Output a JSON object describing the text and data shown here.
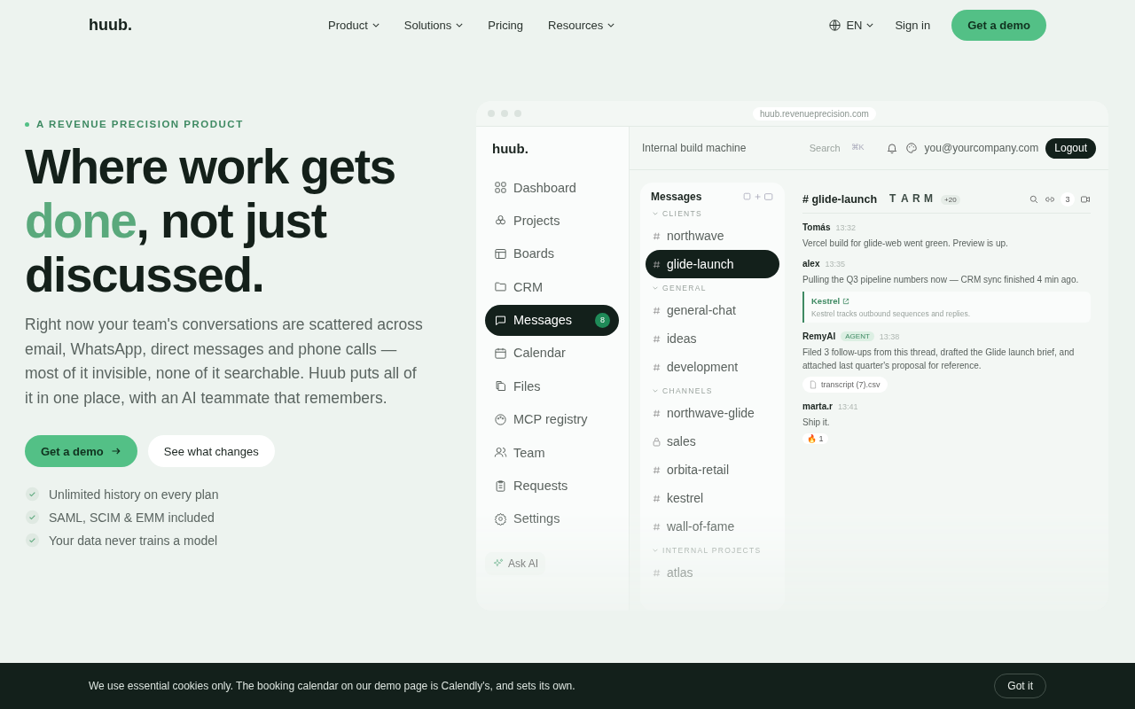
{
  "nav": {
    "logo": "huub.",
    "links": [
      {
        "label": "Product",
        "dropdown": true
      },
      {
        "label": "Solutions",
        "dropdown": true
      },
      {
        "label": "Pricing",
        "dropdown": false
      },
      {
        "label": "Resources",
        "dropdown": true
      }
    ],
    "language": "EN",
    "sign_in": "Sign in",
    "cta": "Get a demo"
  },
  "hero": {
    "eyebrow": "A REVENUE PRECISION PRODUCT",
    "headline": [
      {
        "text": "Where work gets ",
        "accent": false
      },
      {
        "text": "done",
        "accent": true
      },
      {
        "text": ", not just discussed.",
        "accent": false
      }
    ],
    "body": "Right now your team's conversations are scattered across email, WhatsApp, direct messages and phone calls — most of it invisible, none of it searchable. Huub puts all of it in one place, with an AI teammate that remembers.",
    "primary_button": "Get a demo",
    "secondary_button": "See what changes",
    "checks": [
      "Unlimited history on every plan",
      "SAML, SCIM & EMM included",
      "Your data never trains a model"
    ]
  },
  "app": {
    "url": "huub.revenueprecision.com",
    "logo": "huub.",
    "workspace": "Internal build machine",
    "search": {
      "placeholder": "Search",
      "shortcut": "⌘K"
    },
    "user": "you@yourcompany.com",
    "logout": "Logout",
    "sidebar": [
      {
        "label": "Dashboard",
        "selected": false
      },
      {
        "label": "Projects",
        "selected": false
      },
      {
        "label": "Boards",
        "selected": false
      },
      {
        "label": "CRM",
        "selected": false
      },
      {
        "label": "Messages",
        "selected": true,
        "badge": "8"
      },
      {
        "label": "Calendar",
        "selected": false
      },
      {
        "label": "Files",
        "selected": false
      },
      {
        "label": "MCP registry",
        "selected": false
      },
      {
        "label": "Team",
        "selected": false
      },
      {
        "label": "Requests",
        "selected": false
      },
      {
        "label": "Settings",
        "selected": false
      }
    ],
    "ask_ai": "Ask AI",
    "channels_title": "Messages",
    "sections": [
      {
        "title": "CLIENTS",
        "items": [
          {
            "name": "northwave",
            "kind": "public",
            "selected": false
          },
          {
            "name": "glide-launch",
            "kind": "public",
            "selected": true
          }
        ]
      },
      {
        "title": "GENERAL",
        "items": [
          {
            "name": "general-chat",
            "kind": "public",
            "selected": false
          },
          {
            "name": "ideas",
            "kind": "public",
            "selected": false
          },
          {
            "name": "development",
            "kind": "public",
            "selected": false
          }
        ]
      },
      {
        "title": "CHANNELS",
        "items": [
          {
            "name": "northwave-glide",
            "kind": "public",
            "selected": false
          },
          {
            "name": "sales",
            "kind": "private",
            "selected": false
          },
          {
            "name": "orbita-retail",
            "kind": "public",
            "selected": false
          },
          {
            "name": "kestrel",
            "kind": "public",
            "selected": false
          },
          {
            "name": "wall-of-fame",
            "kind": "public",
            "selected": false
          }
        ]
      },
      {
        "title": "INTERNAL PROJECTS",
        "items": [
          {
            "name": "atlas",
            "kind": "public",
            "selected": false
          }
        ]
      }
    ],
    "chat": {
      "hash": "#",
      "channel": "glide-launch",
      "avatars": [
        "T",
        "A",
        "R",
        "M"
      ],
      "more_members": "+20",
      "link_count": "3",
      "messages": [
        {
          "author": "Tomás",
          "time": "13:32",
          "text": "Vercel build for glide-web went green. Preview is up."
        },
        {
          "author": "alex",
          "time": "13:35",
          "text": "Pulling the Q3 pipeline numbers now — CRM sync finished 4 min ago.",
          "quote": {
            "title": "Kestrel",
            "text": "Kestrel tracks outbound sequences and replies."
          }
        },
        {
          "author": "RemyAI",
          "badge": "AGENT",
          "time": "13:38",
          "text": "Filed 3 follow-ups from this thread, drafted the Glide launch brief, and attached last quarter's proposal for reference.",
          "attachment": "transcript (7).csv"
        },
        {
          "author": "marta.r",
          "time": "13:41",
          "text": "Ship it.",
          "reaction": {
            "emoji": "🔥",
            "count": "1"
          }
        }
      ]
    }
  },
  "cookie": {
    "text": "We use essential cookies only. The booking calendar on our demo page is Calendly's, and sets its own.",
    "button": "Got it"
  }
}
